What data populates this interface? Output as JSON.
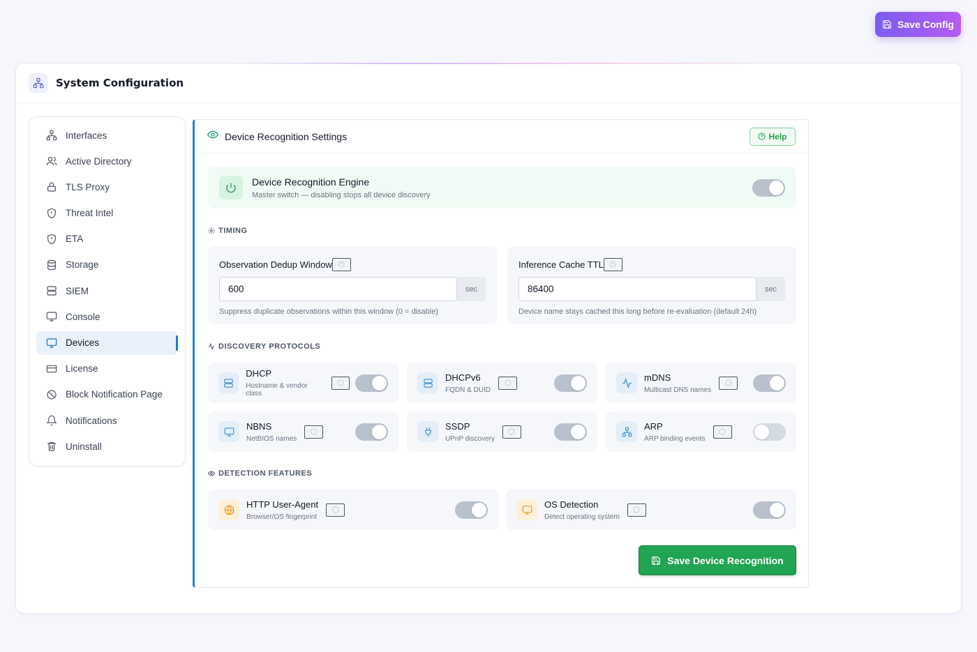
{
  "top_button": {
    "label": "Save Config",
    "icon": "save-icon"
  },
  "header": {
    "title": "System Configuration",
    "icon": "network-icon"
  },
  "sidebar": {
    "items": [
      {
        "label": "Interfaces",
        "icon": "network-icon"
      },
      {
        "label": "Active Directory",
        "icon": "users-icon"
      },
      {
        "label": "TLS Proxy",
        "icon": "lock-icon"
      },
      {
        "label": "Threat Intel",
        "icon": "shield-icon"
      },
      {
        "label": "ETA",
        "icon": "shield-icon"
      },
      {
        "label": "Storage",
        "icon": "database-icon"
      },
      {
        "label": "SIEM",
        "icon": "server-icon"
      },
      {
        "label": "Console",
        "icon": "monitor-icon"
      },
      {
        "label": "Devices",
        "icon": "monitor-icon",
        "active": true
      },
      {
        "label": "License",
        "icon": "card-icon"
      },
      {
        "label": "Block Notification Page",
        "icon": "block-icon"
      },
      {
        "label": "Notifications",
        "icon": "bell-icon"
      },
      {
        "label": "Uninstall",
        "icon": "trash-icon"
      }
    ]
  },
  "panel": {
    "title": "Device Recognition Settings",
    "help_label": "Help",
    "engine": {
      "title": "Device Recognition Engine",
      "subtitle": "Master switch — disabling stops all device discovery",
      "enabled": true
    },
    "timing": {
      "label": "TIMING",
      "dedup": {
        "label": "Observation Dedup Window",
        "value": "600",
        "unit": "sec",
        "help": "Suppress duplicate observations within this window (0 = disable)"
      },
      "cache": {
        "label": "Inference Cache TTL",
        "value": "86400",
        "unit": "sec",
        "help": "Device name stays cached this long before re-evaluation (default 24h)"
      }
    },
    "discovery": {
      "label": "DISCOVERY PROTOCOLS",
      "protocols": [
        {
          "name": "DHCP",
          "sub": "Hostname & vendor class",
          "enabled": true,
          "icon": "server-icon"
        },
        {
          "name": "DHCPv6",
          "sub": "FQDN & DUID",
          "enabled": true,
          "icon": "server-icon"
        },
        {
          "name": "mDNS",
          "sub": "Multicast DNS names",
          "enabled": true,
          "icon": "activity-icon"
        },
        {
          "name": "NBNS",
          "sub": "NetBIOS names",
          "enabled": true,
          "icon": "monitor-icon"
        },
        {
          "name": "SSDP",
          "sub": "UPnP discovery",
          "enabled": true,
          "icon": "plug-icon"
        },
        {
          "name": "ARP",
          "sub": "ARP binding events",
          "enabled": false,
          "icon": "network-icon"
        }
      ]
    },
    "detection": {
      "label": "DETECTION FEATURES",
      "features": [
        {
          "name": "HTTP User-Agent",
          "sub": "Browser/OS fingerprint",
          "enabled": true,
          "icon": "globe-icon"
        },
        {
          "name": "OS Detection",
          "sub": "Detect operating system",
          "enabled": true,
          "icon": "monitor-icon"
        }
      ]
    },
    "save_label": "Save Device Recognition"
  },
  "colors": {
    "accent": "#1f87c7",
    "save_green": "#21a453",
    "gradient_start": "#7c5cf0",
    "gradient_end": "#b75cf2"
  }
}
